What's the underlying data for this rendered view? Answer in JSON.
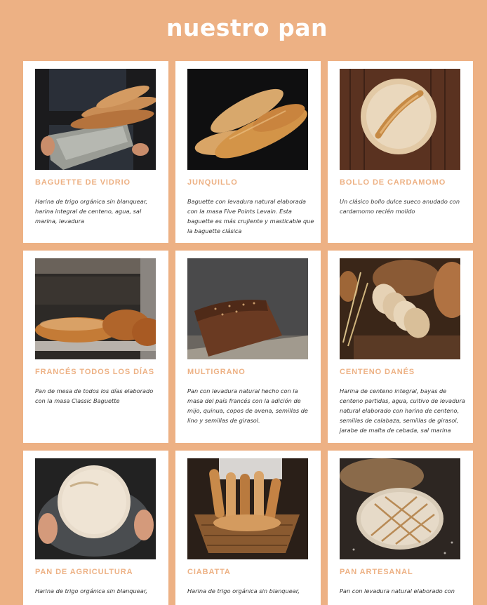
{
  "page": {
    "title": "nuestro pan"
  },
  "theme": {
    "background": "#EDB184",
    "accent": "#EDB184",
    "card": "#FFFFFF",
    "text": "#333333"
  },
  "products": [
    {
      "name": "BAGUETTE DE VIDRIO",
      "description": "Harina de trigo orgánica sin blanquear, harina integral de centeno, agua, sal marina, levadura",
      "image": "baguettes-wrapped-in-cloth-photo"
    },
    {
      "name": "JUNQUILLO",
      "description": "Baguette con levadura natural elaborada con la masa Five Points Levain. Esta baguette es más crujiente y masticable que la baguette clásica",
      "image": "baguettes-on-dark-surface-photo"
    },
    {
      "name": "BOLLO DE CARDAMOMO",
      "description": "Un clásico bollo dulce sueco anudado con cardamomo recién molido",
      "image": "round-loaf-on-wood-photo"
    },
    {
      "name": "FRANCÉS TODOS LOS DÍAS",
      "description": "Pan de mesa de todos los días elaborado con la masa Classic Baguette",
      "image": "loaves-in-oven-photo"
    },
    {
      "name": "MULTIGRANO",
      "description": "Pan con levadura natural hecho con la masa del país francés con la adición de mijo, quinua, copos de avena, semillas de lino y semillas de girasol.",
      "image": "multigrain-loaf-photo"
    },
    {
      "name": "CENTENO DANÉS",
      "description": "Harina de centeno integral, bayas de centeno partidas, agua, cultivo de levadura natural elaborado con harina de centeno, semillas de calabaza, semillas de girasol, jarabe de malta de cebada, sal marina",
      "image": "sliced-rye-bread-photo"
    },
    {
      "name": "PAN DE AGRICULTURA",
      "description": "Harina de trigo orgánica sin blanquear,",
      "image": "hands-holding-loaf-photo"
    },
    {
      "name": "CIABATTA",
      "description": "Harina de trigo orgánica sin blanquear,",
      "image": "bread-basket-photo"
    },
    {
      "name": "PAN ARTESANAL",
      "description": "Pan con levadura natural elaborado con",
      "image": "artisan-round-loaf-photo"
    }
  ]
}
